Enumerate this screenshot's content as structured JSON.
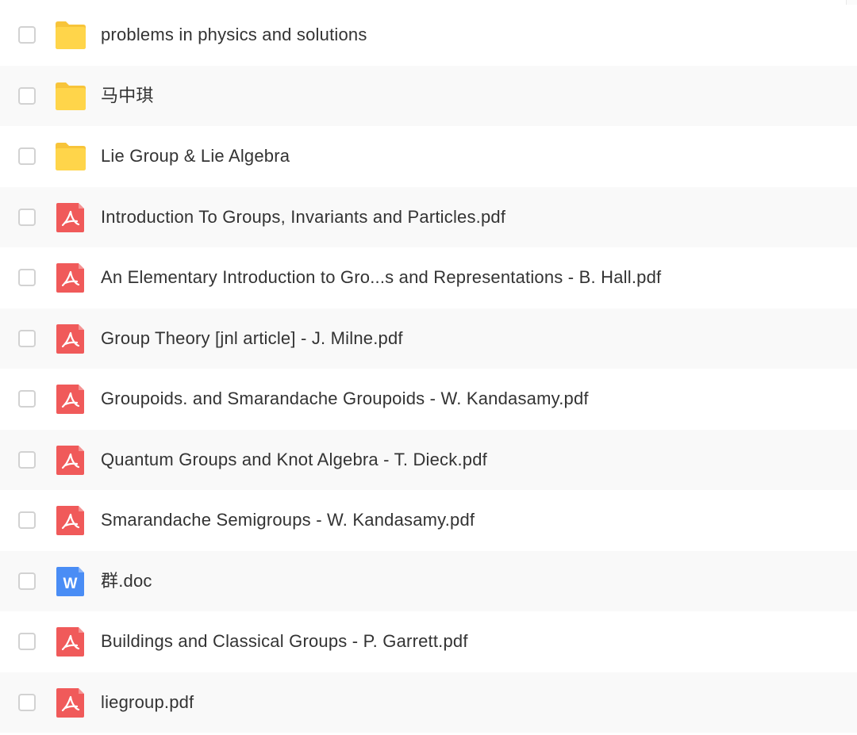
{
  "colors": {
    "folder": "#ffd54a",
    "folder_tab": "#f7c43a",
    "pdf": "#f05a5a",
    "doc": "#4a8df5",
    "text": "#333333",
    "row_alt": "#f9f9f9"
  },
  "files": [
    {
      "name": "problems in physics and solutions",
      "type": "folder",
      "icon": "folder-icon"
    },
    {
      "name": "马中琪",
      "type": "folder",
      "icon": "folder-icon"
    },
    {
      "name": "Lie Group & Lie Algebra",
      "type": "folder",
      "icon": "folder-icon"
    },
    {
      "name": "Introduction To Groups, Invariants and Particles.pdf",
      "type": "pdf",
      "icon": "pdf-icon"
    },
    {
      "name": "An Elementary Introduction to Gro...s and Representations - B. Hall.pdf",
      "type": "pdf",
      "icon": "pdf-icon"
    },
    {
      "name": "Group Theory [jnl article] - J. Milne.pdf",
      "type": "pdf",
      "icon": "pdf-icon"
    },
    {
      "name": "Groupoids. and Smarandache Groupoids - W. Kandasamy.pdf",
      "type": "pdf",
      "icon": "pdf-icon"
    },
    {
      "name": "Quantum Groups and Knot Algebra - T. Dieck.pdf",
      "type": "pdf",
      "icon": "pdf-icon"
    },
    {
      "name": "Smarandache Semigroups - W. Kandasamy.pdf",
      "type": "pdf",
      "icon": "pdf-icon"
    },
    {
      "name": "群.doc",
      "type": "doc",
      "icon": "word-doc-icon",
      "icon_letter": "W"
    },
    {
      "name": "Buildings and Classical Groups - P. Garrett.pdf",
      "type": "pdf",
      "icon": "pdf-icon"
    },
    {
      "name": "liegroup.pdf",
      "type": "pdf",
      "icon": "pdf-icon"
    }
  ]
}
